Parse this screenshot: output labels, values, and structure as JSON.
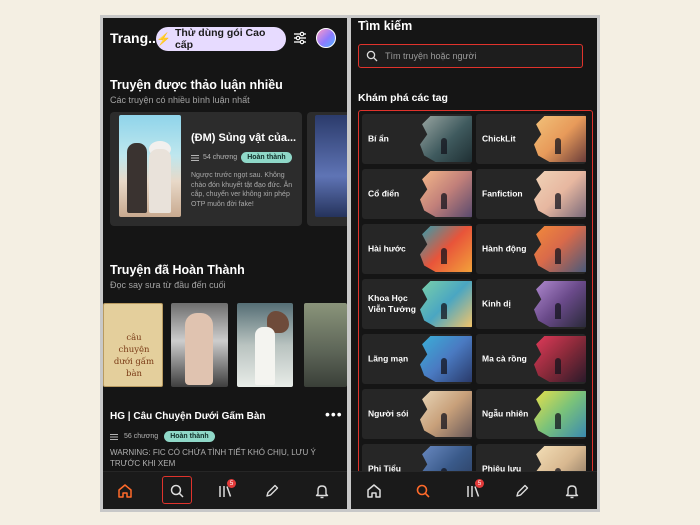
{
  "left": {
    "header": {
      "title": "Trang...",
      "premium_label": "Thử dùng gói Cao cấp"
    },
    "discussed": {
      "title": "Truyện được thảo luận nhiều",
      "subtitle": "Các truyện có nhiều bình luận nhất",
      "card": {
        "title": "(ĐM) Sủng vật của...",
        "chapters": "54 chương",
        "status": "Hoàn thành",
        "description": "Ngược trước ngọt sau. Không chào đón khuyết tật đạo đức. Ăn cắp, chuyển ver không xin phép OTP muôn đời fake!"
      }
    },
    "completed": {
      "title": "Truyện đã Hoàn Thành",
      "subtitle": "Đọc say sưa từ đầu đến cuối",
      "book1_script": "câu chuyện dưới gấm bàn",
      "item": {
        "title": "HG | Câu Chuyện Dưới Gấm Bàn",
        "chapters": "56 chương",
        "status": "Hoàn thành",
        "warning": "WARNING: FIC CÓ CHỨA TÌNH TIẾT KHÓ CHỊU, LƯU Ý TRƯỚC KHI XEM"
      }
    },
    "nav": {
      "badge": "5"
    }
  },
  "right": {
    "title": "Tìm kiếm",
    "search_placeholder": "Tìm truyện hoặc người",
    "tags_heading": "Khám phá các tag",
    "tags": [
      {
        "label": "Bí ẩn",
        "art": "linear-gradient(135deg,#9aa6a2,#3f5a5e 55%,#1f2f33)"
      },
      {
        "label": "ChickLit",
        "art": "linear-gradient(135deg,#f2c27a,#e79a5a 50%,#6b3d3a)"
      },
      {
        "label": "Cổ điển",
        "art": "linear-gradient(135deg,#f4b98a,#c2807a 50%,#5a4a6e)"
      },
      {
        "label": "Fanfiction",
        "art": "linear-gradient(135deg,#f0d4b8,#e7b7a0 50%,#7a6a7a)"
      },
      {
        "label": "Hài hước",
        "art": "linear-gradient(135deg,#2f9fb0,#e8543a 50%,#f2a23a)"
      },
      {
        "label": "Hành động",
        "art": "linear-gradient(135deg,#f28a3a,#d96a4a 45%,#4a5a7a)"
      },
      {
        "label": "Khoa Học Viễn Tưởng",
        "art": "linear-gradient(135deg,#7ad0a8,#4aa6c2 50%,#f2c46a)"
      },
      {
        "label": "Kinh dị",
        "art": "linear-gradient(135deg,#b08ad0,#6a4a8a 50%,#2a2a3a)"
      },
      {
        "label": "Lãng mạn",
        "art": "linear-gradient(135deg,#3ab0d8,#4a7ac2 50%,#2a3a6a)"
      },
      {
        "label": "Ma cà rồng",
        "art": "linear-gradient(135deg,#e23a5a,#8a2a3a 50%,#2a1a2a)"
      },
      {
        "label": "Người sói",
        "art": "linear-gradient(135deg,#e8d6b8,#c8a07a 50%,#6a5a5a)"
      },
      {
        "label": "Ngẫu nhiên",
        "art": "linear-gradient(135deg,#e8e04a,#7ac27a 50%,#3a8ab0)"
      },
      {
        "label": "Phi Tiểu",
        "art": "linear-gradient(135deg,#6a8ac2,#3a5a8a 50%,#2a3a5a)"
      },
      {
        "label": "Phiêu lưu",
        "art": "linear-gradient(135deg,#f4e0b8,#d8b890 50%,#7a6a5a)"
      }
    ],
    "nav": {
      "badge": "5"
    }
  }
}
